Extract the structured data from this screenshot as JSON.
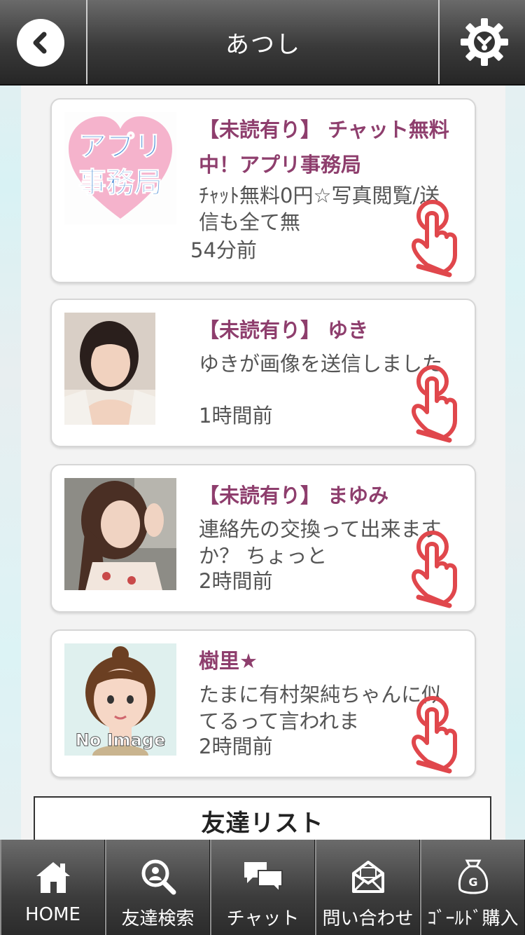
{
  "header": {
    "title": "あつし",
    "back_icon": "chevron-left-icon",
    "settings_icon": "gear-icon"
  },
  "messages": [
    {
      "title": "【未読有り】 チャット無料中！アプリ事務局",
      "preview": "ﾁｬｯﾄ無料0円☆写真閲覧/送信も全て無",
      "time": "54分前",
      "avatar": "app-office-logo",
      "avatar_text": "アプリ\n事務局"
    },
    {
      "title": "【未読有り】 ゆき",
      "preview": "ゆきが画像を送信しました",
      "time": "1時間前",
      "avatar": "user-photo"
    },
    {
      "title": "【未読有り】 まゆみ",
      "preview": "連絡先の交換って出来ますか？ ちょっと",
      "time": "2時間前",
      "avatar": "user-photo"
    },
    {
      "title": "樹里★",
      "preview": "たまに有村架純ちゃんに似てるって言われま",
      "time": "2時間前",
      "avatar": "no-image-illustration",
      "avatar_text": "No Image"
    }
  ],
  "friend_list": {
    "label": "友達リスト"
  },
  "nav": [
    {
      "label": "HOME",
      "icon": "home-icon"
    },
    {
      "label": "友達検索",
      "icon": "search-user-icon"
    },
    {
      "label": "チャット",
      "icon": "chat-bubbles-icon"
    },
    {
      "label": "問い合わせ",
      "icon": "mail-icon"
    },
    {
      "label": "ｺﾞｰﾙﾄﾞ購入",
      "icon": "gold-bag-icon"
    }
  ],
  "colors": {
    "accent_title": "#8e3e6d",
    "header_dark": "#2b2b2b",
    "finger_red": "#e0474c"
  }
}
